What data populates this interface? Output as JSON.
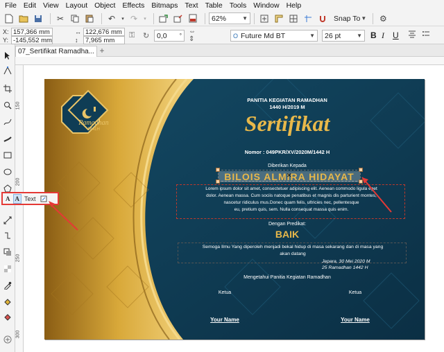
{
  "menubar": {
    "items": [
      "File",
      "Edit",
      "View",
      "Layout",
      "Object",
      "Effects",
      "Bitmaps",
      "Text",
      "Table",
      "Tools",
      "Window",
      "Help"
    ]
  },
  "toolbar1": {
    "zoom_value": "62%",
    "snap_label": "Snap To"
  },
  "toolbar2": {
    "x_label": "X:",
    "x_value": "157,366 mm",
    "y_label": "Y:",
    "y_value": "-145,552 mm",
    "w_value": "122,676 mm",
    "h_value": "7,965 mm",
    "angle_value": "0,0",
    "font_name": "Future Md BT",
    "font_size": "26 pt"
  },
  "tabs": {
    "doc_tab": "07_Sertifikat Ramadha...",
    "add_tab": "+"
  },
  "ruler": {
    "left_numbers": [
      "150",
      "200",
      "250",
      "300"
    ]
  },
  "text_property_bar": {
    "text_label": "Text"
  },
  "certificate": {
    "badge_title": "Ramadhan",
    "badge_year": "1441H",
    "committee_line1": "PANITIA KEGIATAN RAMADHAN",
    "committee_line2": "1440 H/2019 M",
    "title": "Sertifikat",
    "number": "Nomor : 049PKR/XV/2020M/1442 H",
    "given_to": "Diberikan Kepada",
    "recipient": "BILOIS ALMIRA HIDAYAT",
    "body_line1": "Lorem ipsum dolor sit amet, consectetuer adipiscing elit. Aenean commodo ligula eget",
    "body_line2": "dolor. Aenean massa. Cum sociis natoque penatibus et magnis dis parturient montes,",
    "body_line3": "nascetur ridiculus mus.Donec quam felis, ultricies nec, pellentesque",
    "body_line4": "eu, pretium quis, sem. Nulla consequat massa quis enim.",
    "predicate_label": "Dengan Predikat:",
    "predicate": "BAIK",
    "wish_line1": "Semoga Ilmu Yang diperoleh menjadi bekal hidup di masa sekarang dan di masa yang",
    "wish_line2": "akan datang",
    "place_date": "Jepara, 30 Mei 2020 M",
    "hijri_date": "25 Ramadhan 1442 H",
    "acknowledged": "Mengetahui Panitia Kegiatan Ramadhan",
    "left_role": "Ketua",
    "right_role": "Ketua",
    "left_name": "Your Name",
    "right_name": "Your Name"
  },
  "colors": {
    "gold": "#d4a635",
    "navy": "#0f3d55",
    "highlight": "#e53935",
    "selection": "#cfe3f7"
  }
}
